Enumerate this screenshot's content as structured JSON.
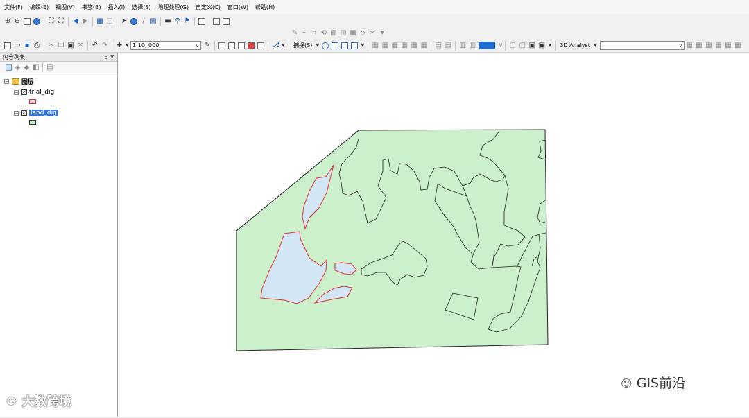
{
  "menu": [
    "文件(F)",
    "编辑(E)",
    "视图(V)",
    "书签(B)",
    "插入(I)",
    "选择(S)",
    "地理处理(G)",
    "自定义(C)",
    "窗口(W)",
    "帮助(H)"
  ],
  "toolbar": {
    "scale_value": "1:10, 000",
    "snapping_label": "捕捉(S)",
    "analyst_label": "3D Analyst",
    "accent_color": "#1f6fd1"
  },
  "toc": {
    "title": "内容列表",
    "root_label": "图层",
    "layers": [
      {
        "name": "trial_dig",
        "checked": true,
        "selected": false,
        "symbol_fill": "#f4d2dc",
        "symbol_stroke": "#c33"
      },
      {
        "name": "land_dig",
        "checked": true,
        "selected": true,
        "symbol_fill": "#c9f0c9",
        "symbol_stroke": "#333"
      }
    ]
  },
  "map": {
    "land_fill": "#cbf0cb",
    "land_stroke": "#222",
    "trial_fill": "#d2e6f5",
    "trial_stroke": "#d33"
  },
  "watermarks": {
    "right": "GIS前沿",
    "left": "大数跨境"
  }
}
